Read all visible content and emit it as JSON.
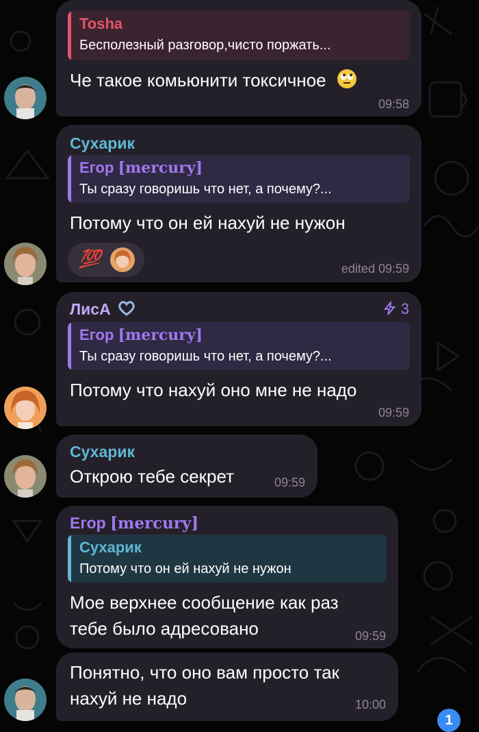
{
  "messages": [
    {
      "reply": {
        "name": "Tosha",
        "text": "Бесполезный разговор,чисто поржать..."
      },
      "text": "Че такое комьюнити токсичное",
      "emoji": "rolling-eyes-emoji",
      "time": "09:58"
    },
    {
      "sender": "Сухарик",
      "reply": {
        "name": "Егор",
        "name_tag": "[mercury]",
        "text": "Ты сразу говоришь что нет, а почему?..."
      },
      "text": "Потому что он ей нахуй не нужон",
      "reaction": {
        "emoji": "💯",
        "icon": "hundred-points-icon"
      },
      "time": "edited 09:59"
    },
    {
      "sender": "ЛисА",
      "boost": "3",
      "reply": {
        "name": "Егор",
        "name_tag": "[mercury]",
        "text": "Ты сразу говоришь что нет, а почему?..."
      },
      "text": "Потому что нахуй оно мне не надо",
      "time": "09:59"
    },
    {
      "sender": "Сухарик",
      "text": "Открою тебе секрет",
      "time": "09:59"
    },
    {
      "sender": "Егор",
      "sender_tag": "[mercury]",
      "reply": {
        "name": "Сухарик",
        "text": "Потому что он ей нахуй не нужон"
      },
      "text_lines": [
        "Мое верхнее сообщение как раз",
        "тебе было адресовано"
      ],
      "time": "09:59"
    },
    {
      "text_lines": [
        "Понятно, что оно вам просто так",
        "нахуй не надо"
      ],
      "time": "10:00"
    }
  ],
  "unread_badge": "1",
  "colors": {
    "background": "#050505",
    "bubble": "#242029",
    "tosha": "#e4546b",
    "egor": "#a078ef",
    "suharik": "#5fb8d4",
    "lisa": "#c0a8f2",
    "time": "#8c8691"
  }
}
